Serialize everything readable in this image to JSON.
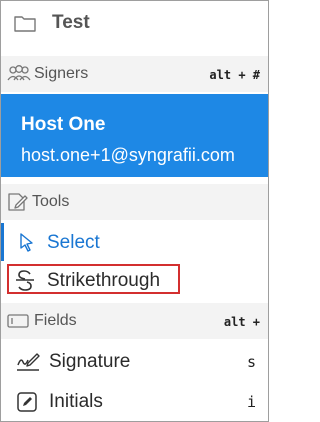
{
  "header": {
    "title": "Test",
    "icon": "folder-icon"
  },
  "signers": {
    "label": "Signers",
    "icon": "users-icon",
    "shortcut": "alt + #",
    "selected": {
      "name": "Host One",
      "email": "host.one+1@syngrafii.com",
      "bg_color": "#1e88e5"
    }
  },
  "tools": {
    "label": "Tools",
    "icon": "tools-icon",
    "items": [
      {
        "label": "Select",
        "icon": "cursor-icon",
        "active": true,
        "color": "#1976d2"
      },
      {
        "label": "Strikethrough",
        "icon": "strikethrough-icon",
        "highlighted": true,
        "outline_color": "#d32f2f"
      }
    ]
  },
  "fields": {
    "label": "Fields",
    "icon": "field-icon",
    "shortcut": "alt +",
    "items": [
      {
        "label": "Signature",
        "icon": "signature-icon",
        "shortcut": "s"
      },
      {
        "label": "Initials",
        "icon": "initials-icon",
        "shortcut": "i"
      }
    ]
  }
}
